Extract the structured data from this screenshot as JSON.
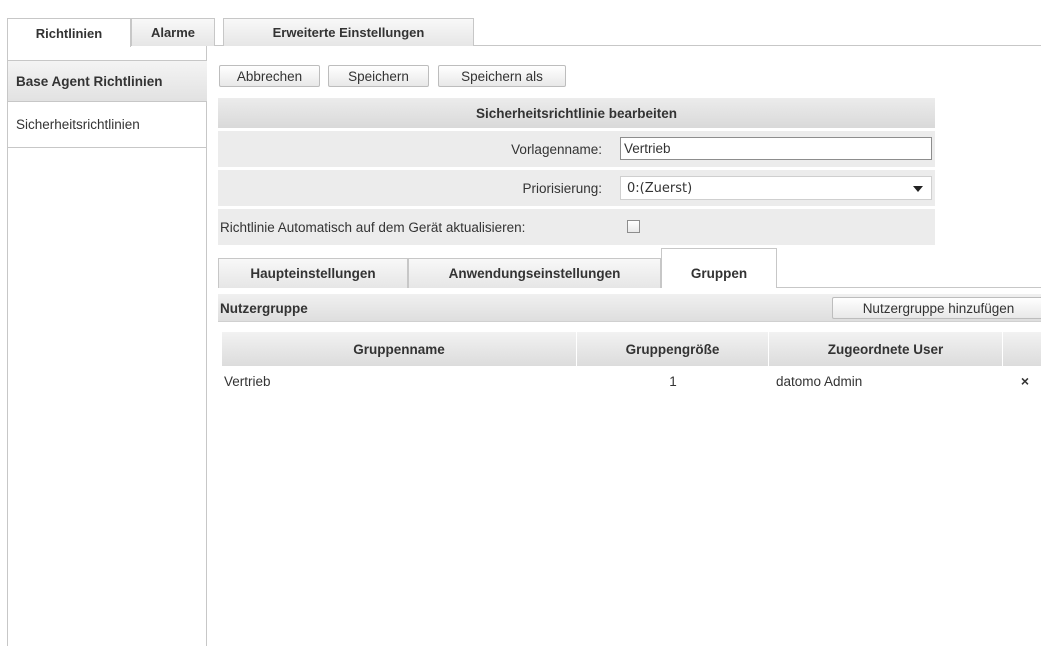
{
  "top_tabs": [
    {
      "label": "Richtlinien",
      "active": true
    },
    {
      "label": "Alarme",
      "active": false
    },
    {
      "label": "Erweiterte Einstellungen",
      "active": false
    }
  ],
  "left_nav": {
    "header": "Base Agent Richtlinien",
    "items": [
      {
        "label": "Sicherheitsrichtlinien"
      }
    ]
  },
  "toolbar": {
    "cancel_label": "Abbrechen",
    "save_label": "Speichern",
    "save_as_label": "Speichern als"
  },
  "form": {
    "title": "Sicherheitsrichtlinie bearbeiten",
    "template_name_label": "Vorlagenname:",
    "template_name_value": "Vertrieb",
    "priority_label": "Priorisierung:",
    "priority_value": "0:(Zuerst)",
    "auto_update_label": "Richtlinie Automatisch auf dem Gerät aktualisieren:",
    "auto_update_checked": false
  },
  "inner_tabs": [
    {
      "label": "Haupteinstellungen",
      "active": false
    },
    {
      "label": "Anwendungseinstellungen",
      "active": false
    },
    {
      "label": "Gruppen",
      "active": true
    }
  ],
  "groups": {
    "section_title": "Nutzergruppe",
    "add_label": "Nutzergruppe hinzufügen",
    "columns": [
      "Gruppenname",
      "Gruppengröße",
      "Zugeordnete User"
    ],
    "rows": [
      {
        "name": "Vertrieb",
        "size": "1",
        "users": "datomo Admin",
        "delete_glyph": "×"
      }
    ]
  }
}
